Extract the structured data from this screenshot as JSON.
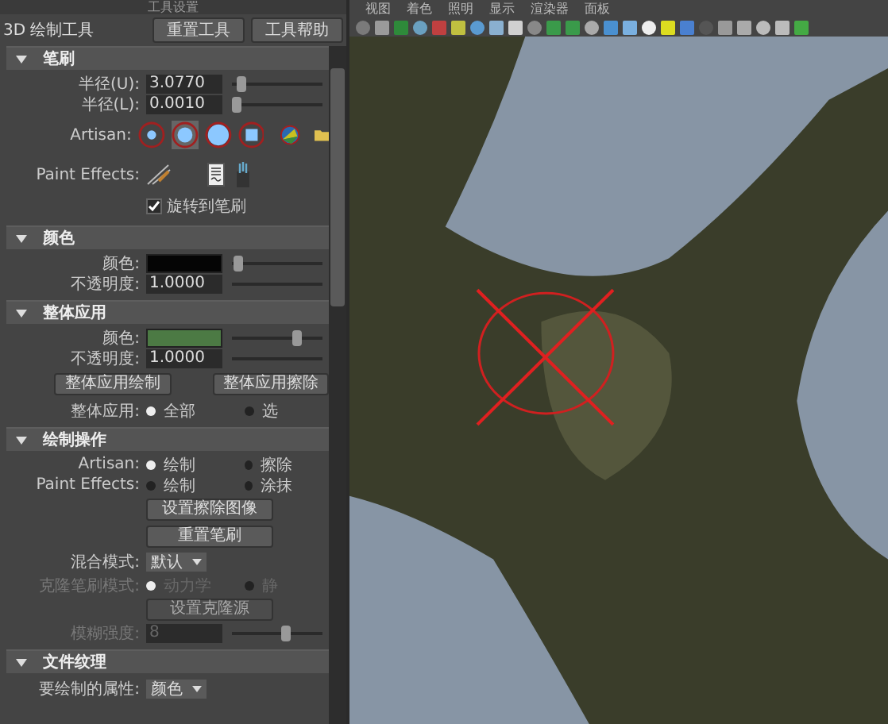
{
  "panel": {
    "title": "工具设置",
    "tool_name": "3D 绘制工具",
    "header_buttons": [
      {
        "label": "重置工具"
      },
      {
        "label": "工具帮助"
      }
    ]
  },
  "sections": [
    {
      "title": "笔刷",
      "expanded": true,
      "rows": [
        {
          "kind": "slider",
          "label": "半径(U):",
          "value": "3.0770",
          "level": 0.05
        },
        {
          "kind": "slider",
          "label": "半径(L):",
          "value": "0.0010",
          "level": 0.0
        },
        {
          "kind": "brushes",
          "label": "Artisan:",
          "brushes": [
            {
              "selected": false
            },
            {
              "selected": true
            },
            {
              "selected": false
            },
            {
              "selected": false
            }
          ]
        },
        {
          "kind": "effects",
          "label": "Paint Effects:"
        },
        {
          "kind": "check",
          "label": "旋转到笔刷",
          "checked": true
        }
      ]
    },
    {
      "title": "颜色",
      "expanded": true,
      "rows": [
        {
          "kind": "color",
          "label": "颜色:",
          "color": "#050505",
          "level": 0.02
        },
        {
          "kind": "field",
          "label": "不透明度:",
          "value": "1.0000"
        }
      ]
    },
    {
      "title": "整体应用",
      "expanded": true,
      "rows": [
        {
          "kind": "color",
          "label": "颜色:",
          "color": "#4c7a44",
          "level": 0.75
        },
        {
          "kind": "field",
          "label": "不透明度:",
          "value": "1.0000"
        },
        {
          "kind": "buttons",
          "buttons": [
            "整体应用绘制",
            "整体应用擦除"
          ]
        },
        {
          "kind": "radio",
          "label": "整体应用:",
          "disabled": false,
          "options": [
            {
              "label": "全部",
              "selected": true
            },
            {
              "label": "选",
              "selected": false
            }
          ]
        }
      ]
    },
    {
      "title": "绘制操作",
      "expanded": true,
      "rows": [
        {
          "kind": "radio",
          "label": "Artisan:",
          "disabled": false,
          "options": [
            {
              "label": "绘制",
              "selected": true
            },
            {
              "label": "擦除",
              "selected": false
            }
          ]
        },
        {
          "kind": "radio",
          "label": "Paint Effects:",
          "disabled": false,
          "options": [
            {
              "label": "绘制",
              "selected": false
            },
            {
              "label": "涂抹",
              "selected": false
            }
          ]
        },
        {
          "kind": "button",
          "label": "设置擦除图像",
          "disabled": false
        },
        {
          "kind": "button",
          "label": "重置笔刷",
          "disabled": false
        },
        {
          "kind": "dropdown",
          "label": "混合模式:",
          "value": "默认"
        },
        {
          "kind": "radio",
          "label": "克隆笔刷模式:",
          "disabled": true,
          "options": [
            {
              "label": "动力学",
              "selected": true
            },
            {
              "label": "静",
              "selected": false
            }
          ]
        },
        {
          "kind": "button",
          "label": "设置克隆源",
          "disabled": true
        },
        {
          "kind": "slider",
          "label": "模糊强度:",
          "value": "8",
          "level": 0.6,
          "disabled": true
        }
      ]
    },
    {
      "title": "文件纹理",
      "expanded": true,
      "rows": [
        {
          "kind": "dropdown",
          "label": "要绘制的属性:",
          "value": "颜色"
        }
      ]
    }
  ],
  "viewport": {
    "menus": [
      "视图",
      "着色",
      "照明",
      "显示",
      "渲染器",
      "面板"
    ]
  }
}
